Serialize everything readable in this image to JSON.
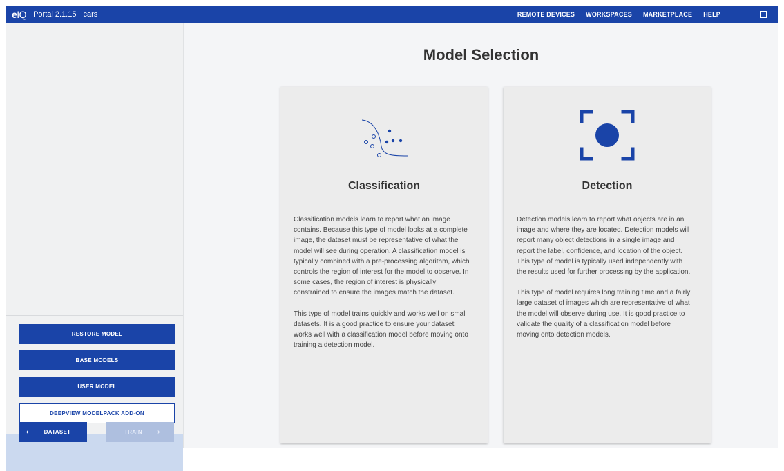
{
  "titlebar": {
    "logo_e": "e",
    "logo_iq": "IQ",
    "app_name": "Portal 2.1.15",
    "project": "cars",
    "nav": [
      "REMOTE DEVICES",
      "WORKSPACES",
      "MARKETPLACE",
      "HELP"
    ],
    "color": "#1a44a8"
  },
  "sidebar": {
    "buttons": {
      "restore": "RESTORE MODEL",
      "base": "BASE MODELS",
      "user": "USER MODEL",
      "addon": "DEEPVIEW MODELPACK ADD-ON"
    },
    "footer": {
      "back_icon": "chevron-left-icon",
      "back": "DATASET",
      "next": "TRAIN",
      "next_icon": "chevron-right-icon"
    }
  },
  "main": {
    "title": "Model Selection",
    "cards": {
      "classification": {
        "icon": "scatter-classification-icon",
        "title": "Classification",
        "paragraphs": [
          "Classification models learn to report what an image contains. Because this type of model looks at a complete image, the dataset must be representative of what the model will see during operation. A classification model is typically combined with a pre-processing algorithm, which controls the region of interest for the model to observe. In some cases, the region of interest is physically constrained to ensure the images match the dataset.",
          "This type of model trains quickly and works well on small datasets. It is a good practice to ensure your dataset works well with a classification model before moving onto training a detection model."
        ]
      },
      "detection": {
        "icon": "focus-target-icon",
        "title": "Detection",
        "paragraphs": [
          "Detection models learn to report what objects are in an image and where they are located. Detection models will report many object detections in a single image and report the label, confidence, and location of the object. This type of model is typically used independently with the results used for further processing by the application.",
          "This type of model requires long training time and a fairly large dataset of images which are representative of what the model will observe during use. It is good practice to validate the quality of a classification model before moving onto detection models."
        ]
      }
    }
  }
}
